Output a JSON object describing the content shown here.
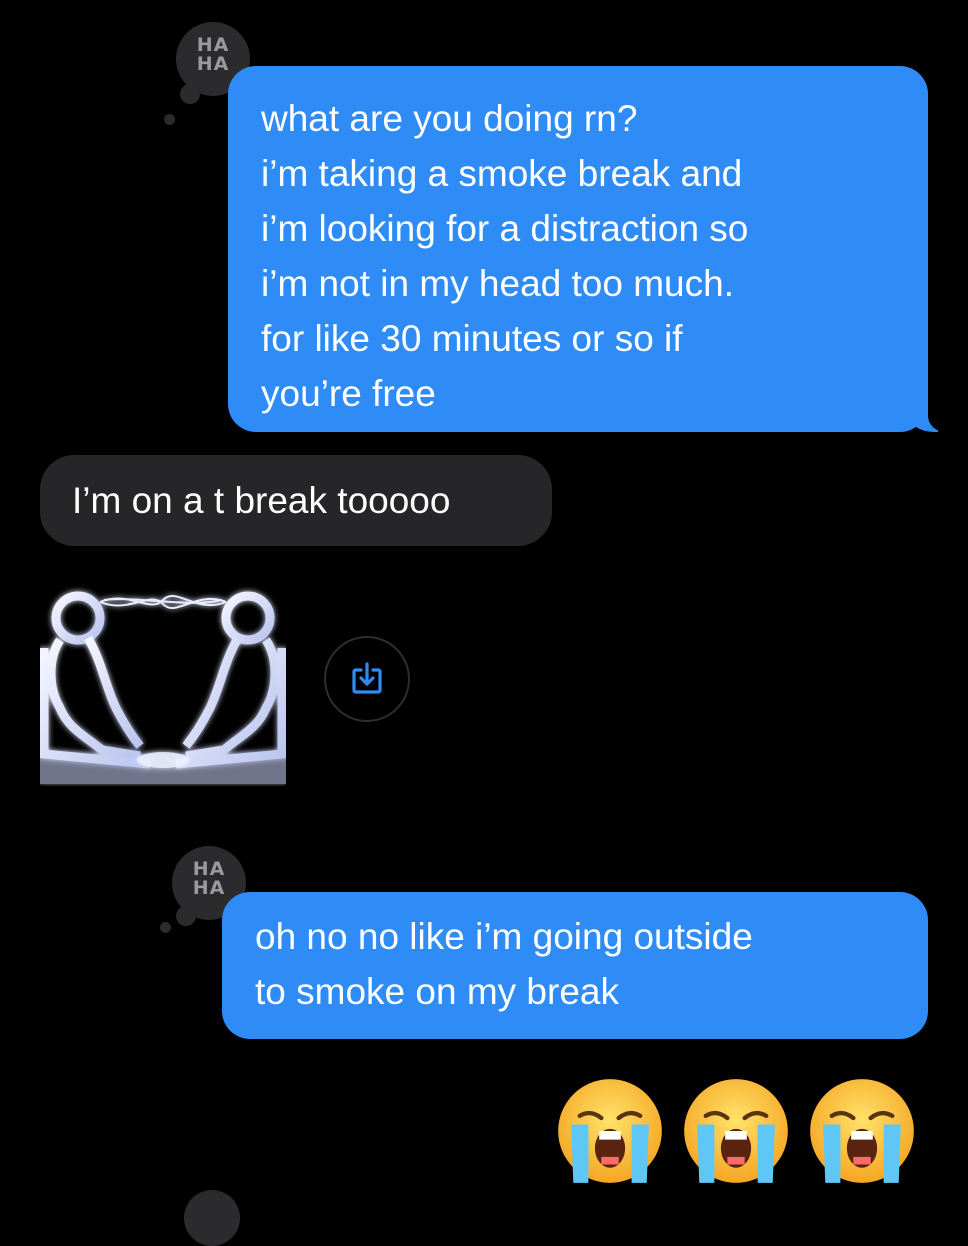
{
  "messages": [
    {
      "sender": "me",
      "tapback": "HA\nHA",
      "lines": [
        "what are you doing rn?",
        "i’m taking a smoke break and",
        "i’m looking for a distraction so",
        "i’m not in my head too much.",
        "for like 30 minutes or so if",
        "you’re free"
      ]
    },
    {
      "sender": "them",
      "text": "I’m on a t break tooooo"
    },
    {
      "sender": "them",
      "attachment": "image"
    },
    {
      "sender": "me",
      "tapback": "HA\nHA",
      "lines": [
        "oh no no like i’m going outside",
        "to smoke on my break"
      ]
    },
    {
      "sender": "me",
      "emoji": [
        "😭",
        "😭",
        "😭"
      ]
    }
  ],
  "tapback_label": {
    "line1": "HA",
    "line2": "HA"
  },
  "icons": {
    "save": "square-arrow-down-icon",
    "tapback": "haha-icon"
  },
  "colors": {
    "background": "#000000",
    "sent_bubble": "#2f8cf7",
    "received_bubble": "#262628",
    "tapback": "#2b2b2d"
  }
}
